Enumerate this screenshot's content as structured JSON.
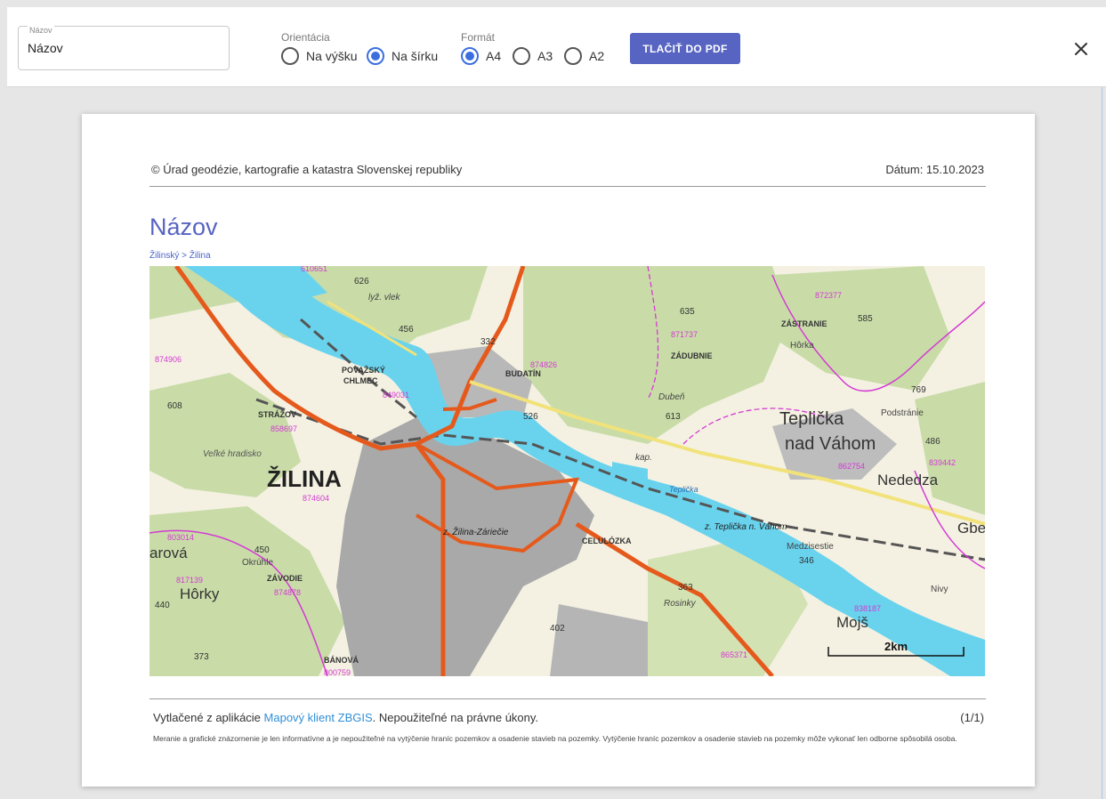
{
  "toolbar": {
    "name_label": "Názov",
    "name_value": "Názov",
    "orientation_label": "Orientácia",
    "orientation_options": [
      "Na výšku",
      "Na šírku"
    ],
    "orientation_selected": "Na šírku",
    "format_label": "Formát",
    "format_options": [
      "A4",
      "A3",
      "A2"
    ],
    "format_selected": "A4",
    "print_button": "TLAČIŤ DO PDF",
    "close_icon": "close-icon"
  },
  "page": {
    "copyright": "© Úrad geodézie, kartografie a katastra Slovenskej republiky",
    "date": "Dátum: 15.10.2023",
    "title": "Názov",
    "breadcrumb": "Žilinský > Žilina",
    "footer_prefix": "Vytlačené z aplikácie ",
    "footer_link": "Mapový klient ZBGIS",
    "footer_suffix": ". Nepoužiteľné na právne úkony.",
    "page_number": "(1/1)",
    "disclaimer": "Meranie a grafické znázornenie je len informatívne a je nepoužiteľné na vytýčenie hraníc pozemkov a osadenie stavieb na pozemky. Vytýčenie hraníc pozemkov a osadenie stavieb na pozemky môže vykonať len odborne spôsobilá osoba."
  },
  "map": {
    "scale": "2km",
    "labels": {
      "zilina": "ŽILINA",
      "teplicka1": "Teplička",
      "teplicka2": "nad Váhom",
      "nededza": "Nededza",
      "mojs": "Mojš",
      "horky": "Hôrky",
      "hradisko": "Veľké hradisko",
      "povazsky1": "POVAŽSKÝ",
      "povazsky2": "CHLMEC",
      "budatin": "BUDATÍN",
      "zadubnie": "ZÁDUBNIE",
      "strazov": "STRÁŽOV",
      "celulozka": "CELULÓZKA",
      "zavodie": "ZÁVODIE",
      "banova": "BÁNOVÁ",
      "zastranie": "ZÁSTRANIE",
      "horka": "Hôrka",
      "duben": "Dubeň",
      "podstranie": "Podstránie",
      "medzisestie": "Medzisestie",
      "zilina_zariecie": "z. Žilina-Záriečie",
      "teplicka_zast": "z. Teplička n. Váhom",
      "rosinky": "Rosinky",
      "okruhle": "Okrúhle",
      "nivy": "Nivy",
      "gbe": "Gbe",
      "arova": "arová",
      "kap": "kap.",
      "lyz_vlek": "lyž. vlek",
      "teplicka_stream": "Teplička",
      "h526": "526",
      "h613": "613",
      "h635": "635",
      "h456": "456",
      "h332": "332",
      "h626": "626",
      "h608": "608",
      "h450": "450",
      "h402": "402",
      "h373": "373",
      "h486": "486",
      "h346": "346",
      "h769": "769",
      "h363": "363",
      "h440": "440",
      "h585": "585",
      "c874826": "874826",
      "c849031": "849031",
      "c871737": "871737",
      "c872377": "872377",
      "c862754": "862754",
      "c839442": "839442",
      "c858697": "858697",
      "c874604": "874604",
      "c803014": "803014",
      "c817139": "817139",
      "c874878": "874878",
      "c838187": "838187",
      "c865371": "865371",
      "c874906": "874906",
      "c800759": "800759",
      "c610651": "610651"
    }
  }
}
